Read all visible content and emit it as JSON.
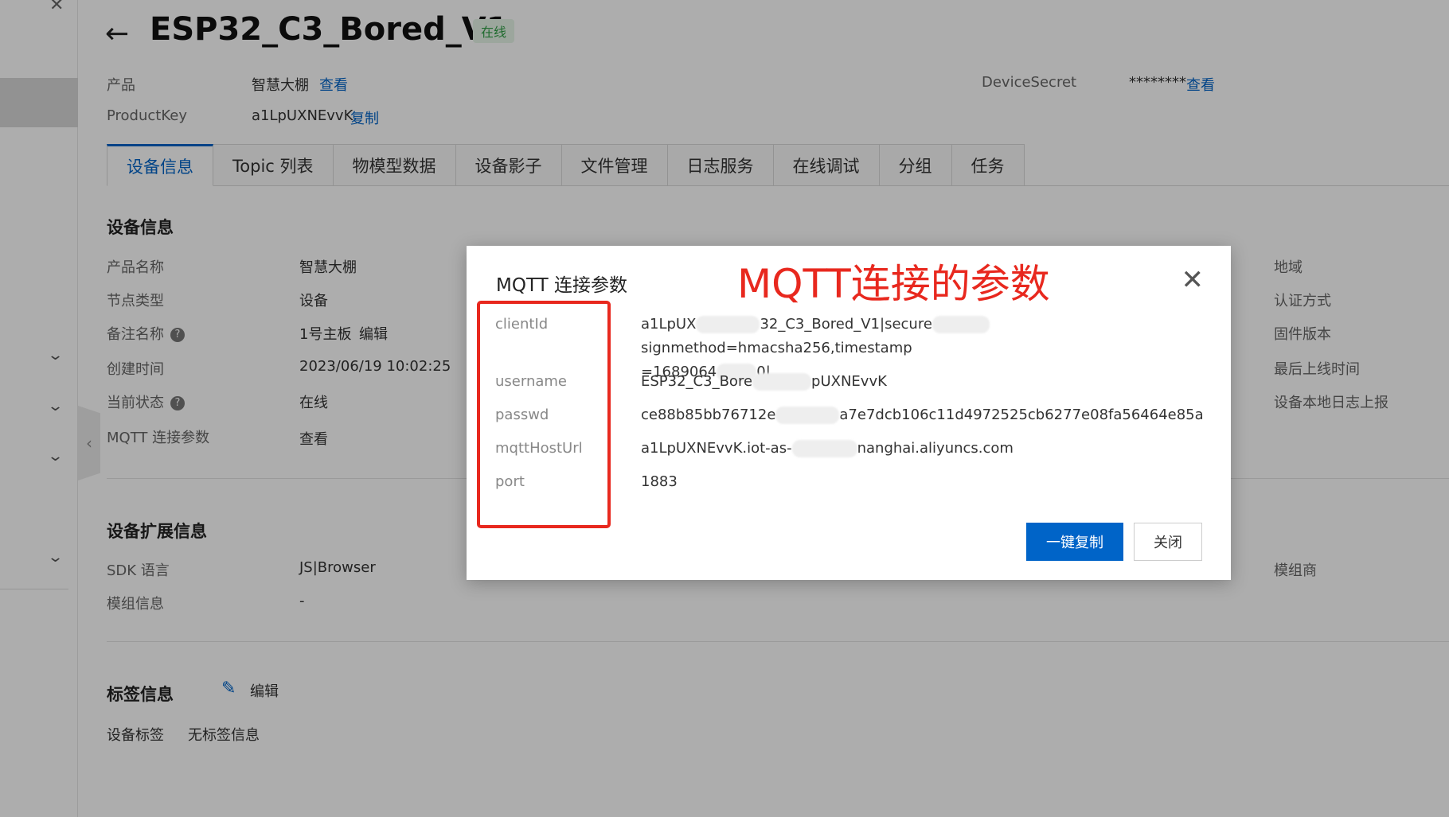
{
  "header": {
    "back_icon": "arrow-left-icon",
    "device_name": "ESP32_C3_Bored_V1",
    "status": "在线",
    "product_label": "产品",
    "product_value": "智慧大棚",
    "product_link": "查看",
    "productkey_label": "ProductKey",
    "productkey_value": "a1LpUXNEvvK",
    "productkey_link": "复制",
    "devicesecret_label": "DeviceSecret",
    "devicesecret_value": "********",
    "devicesecret_link": "查看"
  },
  "tabs": [
    {
      "label": "设备信息",
      "active": true
    },
    {
      "label": "Topic 列表"
    },
    {
      "label": "物模型数据"
    },
    {
      "label": "设备影子"
    },
    {
      "label": "文件管理"
    },
    {
      "label": "日志服务"
    },
    {
      "label": "在线调试"
    },
    {
      "label": "分组"
    },
    {
      "label": "任务"
    }
  ],
  "device_info": {
    "title": "设备信息",
    "rows": [
      {
        "label": "产品名称",
        "value": "智慧大棚"
      },
      {
        "label": "节点类型",
        "value": "设备"
      },
      {
        "label": "备注名称",
        "value": "1号主板",
        "link": "编辑"
      },
      {
        "label": "创建时间",
        "value": "2023/06/19 10:02:25"
      },
      {
        "label": "当前状态",
        "value": "在线"
      },
      {
        "label": "MQTT 连接参数",
        "link": "查看"
      }
    ],
    "right_labels": [
      "地域",
      "认证方式",
      "固件版本",
      "最后上线时间",
      "设备本地日志上报"
    ]
  },
  "ext_info": {
    "title": "设备扩展信息",
    "rows": [
      {
        "label": "SDK 语言",
        "value": "JS|Browser"
      },
      {
        "label": "模组信息",
        "value": "-"
      }
    ],
    "right_label": "模组商"
  },
  "tag_info": {
    "title": "标签信息",
    "edit_icon": "pencil-icon",
    "edit_link": "编辑",
    "tag_label": "设备标签",
    "tag_value": "无标签信息"
  },
  "modal": {
    "title": "MQTT 连接参数",
    "annotation": "MQTT连接的参数",
    "close_icon": "close-icon",
    "params": {
      "clientId_key": "clientId",
      "clientId_a": "a1LpUX",
      "clientId_b": "32_C3_Bored_V1|secure",
      "clientId_c": "signmethod=hmacsha256,timestamp",
      "clientId_d": "=1689064",
      "clientId_e": "0|",
      "username_key": "username",
      "username_a": "ESP32_C3_Bore",
      "username_b": "pUXNEvvK",
      "passwd_key": "passwd",
      "passwd_a": "ce88b85bb76712e",
      "passwd_b": "a7e7dcb106c11d4972525cb6277e08fa56464e85a",
      "host_key": "mqttHostUrl",
      "host_a": "a1LpUXNEvvK.iot-as-",
      "host_b": "nanghai.aliyuncs.com",
      "port_key": "port",
      "port_value": "1883"
    },
    "copy_button": "一键复制",
    "close_button": "关闭"
  }
}
